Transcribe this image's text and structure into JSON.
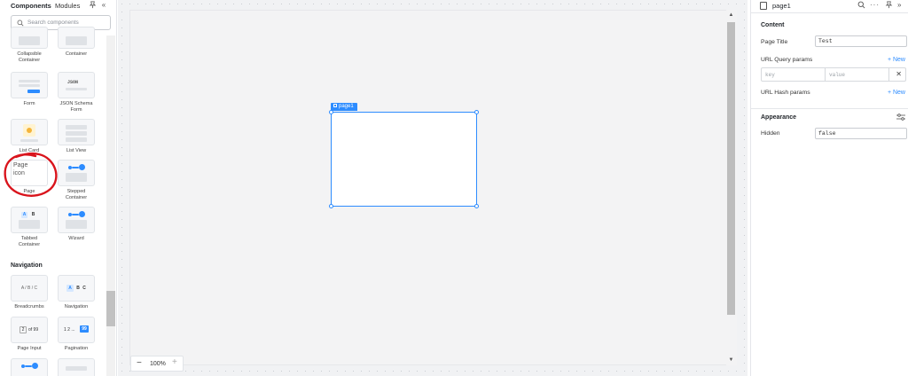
{
  "left_panel": {
    "tabs": [
      "Components",
      "Modules"
    ],
    "search_placeholder": "Search components",
    "components": [
      {
        "label": "Collapsible\nContainer"
      },
      {
        "label": "Container"
      },
      {
        "label": "Form"
      },
      {
        "label": "JSON Schema\nForm"
      },
      {
        "label": "List Card"
      },
      {
        "label": "List View"
      },
      {
        "label": "Page"
      },
      {
        "label": "Stepped\nContainer"
      },
      {
        "label": "Tabbed\nContainer"
      },
      {
        "label": "Wizard"
      }
    ],
    "json_icon_text": "JSON",
    "page_broken_img_text": "Page\nicon",
    "tabbed_icon_letters": [
      "A",
      "B"
    ],
    "nav_section_title": "Navigation",
    "nav_components": [
      {
        "label": "Breadcrumbs",
        "icon_text": "A / B / C"
      },
      {
        "label": "Navigation",
        "icon_letters": [
          "A",
          "B",
          "C"
        ]
      },
      {
        "label": "Page Input",
        "icon_left": "2",
        "icon_right": "of 99"
      },
      {
        "label": "Pagination",
        "icon_left": "1 2 ...",
        "icon_right": "99"
      }
    ]
  },
  "canvas": {
    "page_tag": "page1",
    "zoom": "100%"
  },
  "right_panel": {
    "title": "page1",
    "content_title": "Content",
    "page_title_label": "Page Title",
    "page_title_value": "Test",
    "url_query_label": "URL Query params",
    "new_label": "+ New",
    "key_placeholder": "key",
    "value_placeholder": "value",
    "url_hash_label": "URL Hash params",
    "appearance_title": "Appearance",
    "hidden_label": "Hidden",
    "hidden_value": "false"
  },
  "colors": {
    "accent": "#2d8cff",
    "annotation": "#d9141c"
  }
}
